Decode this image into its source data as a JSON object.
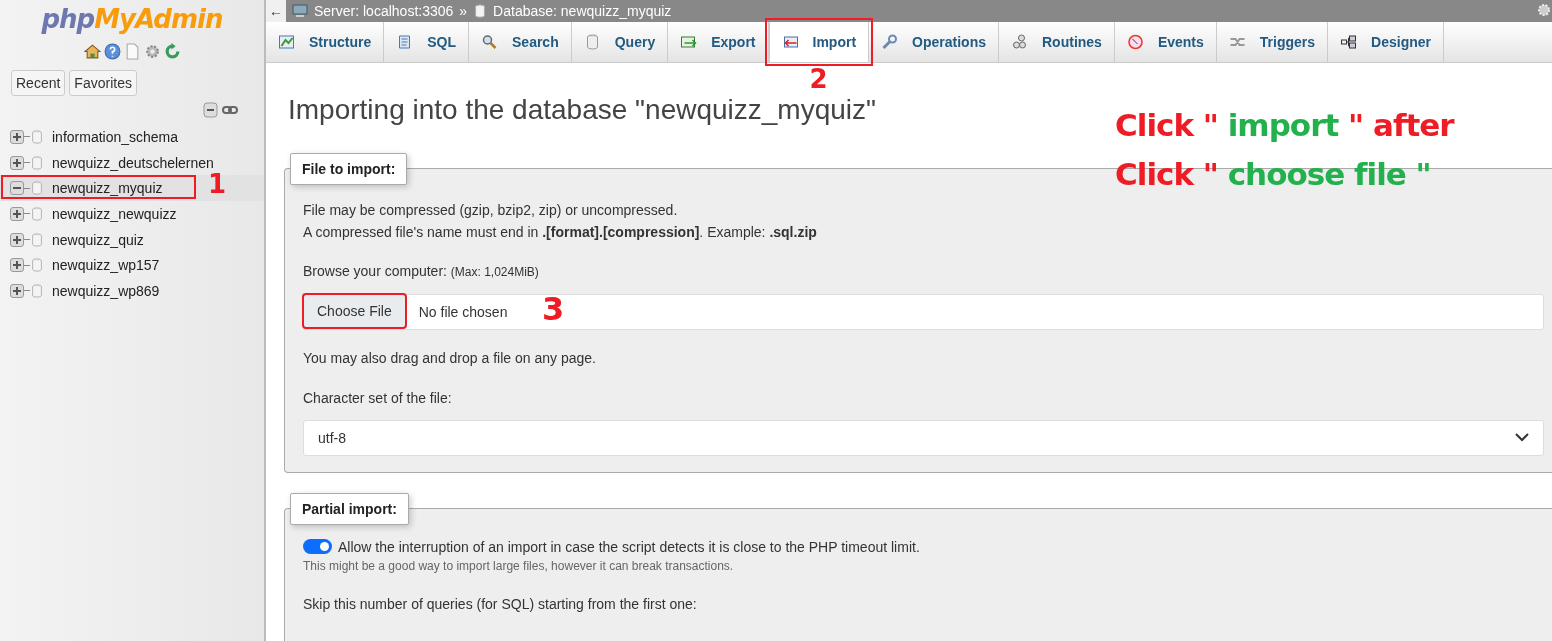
{
  "sidebar": {
    "logo": {
      "prefix": "php",
      "wordmark": "MyAdmin"
    },
    "quick_tabs": [
      "Recent",
      "Favorites"
    ],
    "databases": [
      {
        "name": "information_schema",
        "expanded": false,
        "selected": false
      },
      {
        "name": "newquizz_deutschelernen",
        "expanded": false,
        "selected": false
      },
      {
        "name": "newquizz_myquiz",
        "expanded": true,
        "selected": true,
        "marker": "1"
      },
      {
        "name": "newquizz_newquizz",
        "expanded": false,
        "selected": false
      },
      {
        "name": "newquizz_quiz",
        "expanded": false,
        "selected": false
      },
      {
        "name": "newquizz_wp157",
        "expanded": false,
        "selected": false
      },
      {
        "name": "newquizz_wp869",
        "expanded": false,
        "selected": false
      }
    ]
  },
  "breadcrumb": {
    "back": "←",
    "server": "Server: localhost:3306",
    "separator": "»",
    "database": "Database: newquizz_myquiz"
  },
  "tabs": [
    {
      "label": "Structure",
      "kind": "structure",
      "selected": false
    },
    {
      "label": "SQL",
      "kind": "sql",
      "selected": false
    },
    {
      "label": "Search",
      "kind": "search",
      "selected": false
    },
    {
      "label": "Query",
      "kind": "query",
      "selected": false
    },
    {
      "label": "Export",
      "kind": "export",
      "selected": false
    },
    {
      "label": "Import",
      "kind": "import",
      "selected": true,
      "marker": "2"
    },
    {
      "label": "Operations",
      "kind": "operations",
      "selected": false
    },
    {
      "label": "Routines",
      "kind": "routines",
      "selected": false
    },
    {
      "label": "Events",
      "kind": "events",
      "selected": false
    },
    {
      "label": "Triggers",
      "kind": "triggers",
      "selected": false
    },
    {
      "label": "Designer",
      "kind": "designer",
      "selected": false
    }
  ],
  "page_title": "Importing into the database \"newquizz_myquiz\"",
  "instruction": {
    "lines": [
      [
        {
          "text": "Click \"",
          "color": "#ee1c25"
        },
        {
          "text": " import ",
          "color": "#22b14c"
        },
        {
          "text": "\" after",
          "color": "#ee1c25"
        }
      ],
      [
        {
          "text": "Click \"",
          "color": "#ee1c25"
        },
        {
          "text": " choose file \"",
          "color": "#22b14c"
        }
      ]
    ]
  },
  "file_to_import": {
    "legend": "File to import:",
    "hints": [
      "File may be compressed (gzip, bzip2, zip) or uncompressed.",
      "A compressed file's name must end in **.[format].[compression]**. Example: **.sql.zip**"
    ],
    "browse_label": "Browse your computer:",
    "max_size": "(Max: 1,024MiB)",
    "choose_button": "Choose File",
    "marker": "3",
    "file_status": "No file chosen",
    "drag_hint": "You may also drag and drop a file on any page.",
    "charset_label": "Character set of the file:",
    "charset_value": "utf-8"
  },
  "partial_import": {
    "legend": "Partial import:",
    "allow_interrupt": {
      "label": "Allow the interruption of an import in case the script detects it is close to the PHP timeout limit.",
      "on": true,
      "note": "This might be a good way to import large files, however it can break transactions."
    },
    "skip_label": "Skip this number of queries (for SQL) starting from the first one:"
  }
}
